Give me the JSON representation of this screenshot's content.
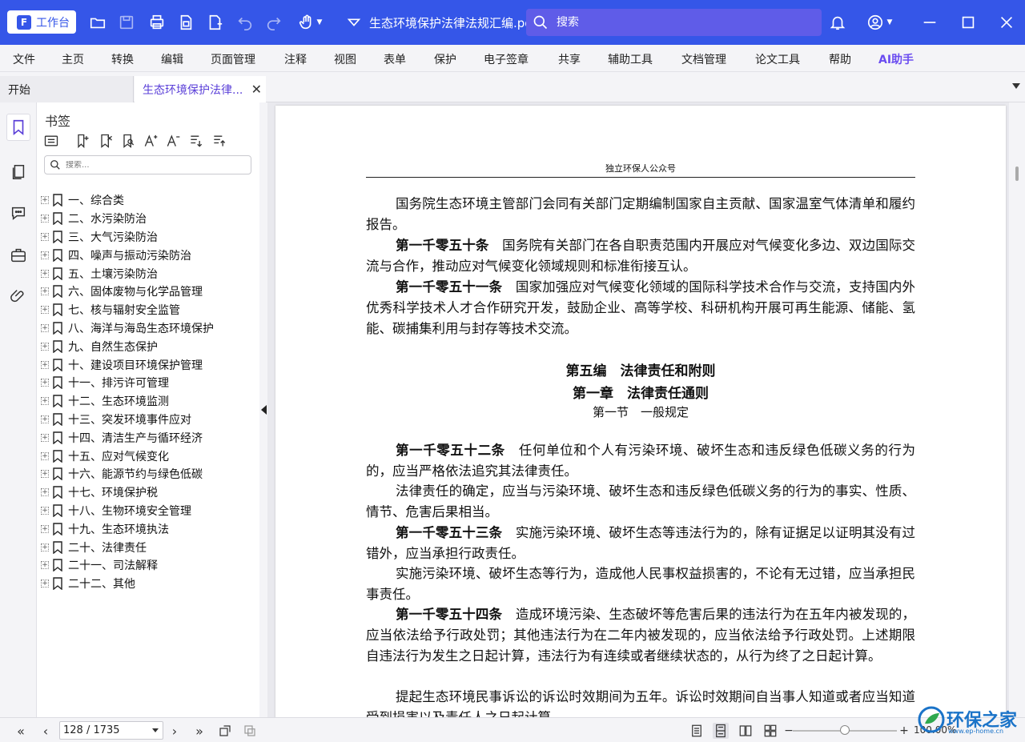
{
  "titlebar": {
    "workspace_label": "工作台",
    "document_title": "生态环境保护法律法规汇编.pdf",
    "search_placeholder": "搜索"
  },
  "menu": [
    "文件",
    "主页",
    "转换",
    "编辑",
    "页面管理",
    "注释",
    "视图",
    "表单",
    "保护",
    "电子签章",
    "共享",
    "辅助工具",
    "文档管理",
    "论文工具",
    "帮助",
    "AI助手"
  ],
  "tabs": {
    "start": "开始",
    "document": "生态环境保护法律..."
  },
  "bookmarks": {
    "title": "书签",
    "search_placeholder": "搜索...",
    "items": [
      "一、综合类",
      "二、水污染防治",
      "三、大气污染防治",
      "四、噪声与振动污染防治",
      "五、土壤污染防治",
      "六、固体废物与化学品管理",
      "七、核与辐射安全监管",
      "八、海洋与海岛生态环境保护",
      "九、自然生态保护",
      "十、建设项目环境保护管理",
      "十一、排污许可管理",
      "十二、生态环境监测",
      "十三、突发环境事件应对",
      "十四、清洁生产与循环经济",
      "十五、应对气候变化",
      "十六、能源节约与绿色低碳",
      "十七、环境保护税",
      "十八、生物环境安全管理",
      "十九、生态环境执法",
      "二十、法律责任",
      "二十一、司法解释",
      "二十二、其他"
    ]
  },
  "document": {
    "header": "独立环保人公众号",
    "p1": "国务院生态环境主管部门会同有关部门定期编制国家自主贡献、国家温室气体清单和履约报告。",
    "a1050_title": "第一千零五十条",
    "a1050_text": "国务院有关部门在各自职责范围内开展应对气候变化多边、双边国际交流与合作，推动应对气候变化领域规则和标准衔接互认。",
    "a1051_title": "第一千零五十一条",
    "a1051_text": "国家加强应对气候变化领域的国际科学技术合作与交流，支持国内外优秀科学技术人才合作研究开发，鼓励企业、高等学校、科研机构开展可再生能源、储能、氢能、碳捕集利用与封存等技术交流。",
    "part_heading": "第五编　法律责任和附则",
    "chapter_heading": "第一章　法律责任通则",
    "section_heading": "第一节　一般规定",
    "a1052_title": "第一千零五十二条",
    "a1052_text": "任何单位和个人有污染环境、破坏生态和违反绿色低碳义务的行为的，应当严格依法追究其法律责任。",
    "p_liability": "法律责任的确定，应当与污染环境、破坏生态和违反绿色低碳义务的行为的事实、性质、情节、危害后果相当。",
    "a1053_title": "第一千零五十三条",
    "a1053_text": "实施污染环境、破坏生态等违法行为的，除有证据足以证明其没有过错外，应当承担行政责任。",
    "p_civil": "实施污染环境、破坏生态等行为，造成他人民事权益损害的，不论有无过错，应当承担民事责任。",
    "a1054_title": "第一千零五十四条",
    "a1054_text": "造成环境污染、生态破坏等危害后果的违法行为在五年内被发现的，应当依法给予行政处罚；其他违法行为在二年内被发现的，应当依法给予行政处罚。上述期限自违法行为发生之日起计算，违法行为有连续或者继续状态的，从行为终了之日起计算。",
    "p_limit": "提起生态环境民事诉讼的诉讼时效期间为五年。诉讼时效期间自当事人知道或者应当知道受到损害以及责任人之日起计算。"
  },
  "status": {
    "page_indicator": "128 / 1735",
    "zoom": "100.00%"
  },
  "watermark": {
    "name": "环保之家",
    "url": "www.ep-home.cn"
  },
  "colors": {
    "titlebar": "#3556e8",
    "accent": "#5a3fd8"
  }
}
